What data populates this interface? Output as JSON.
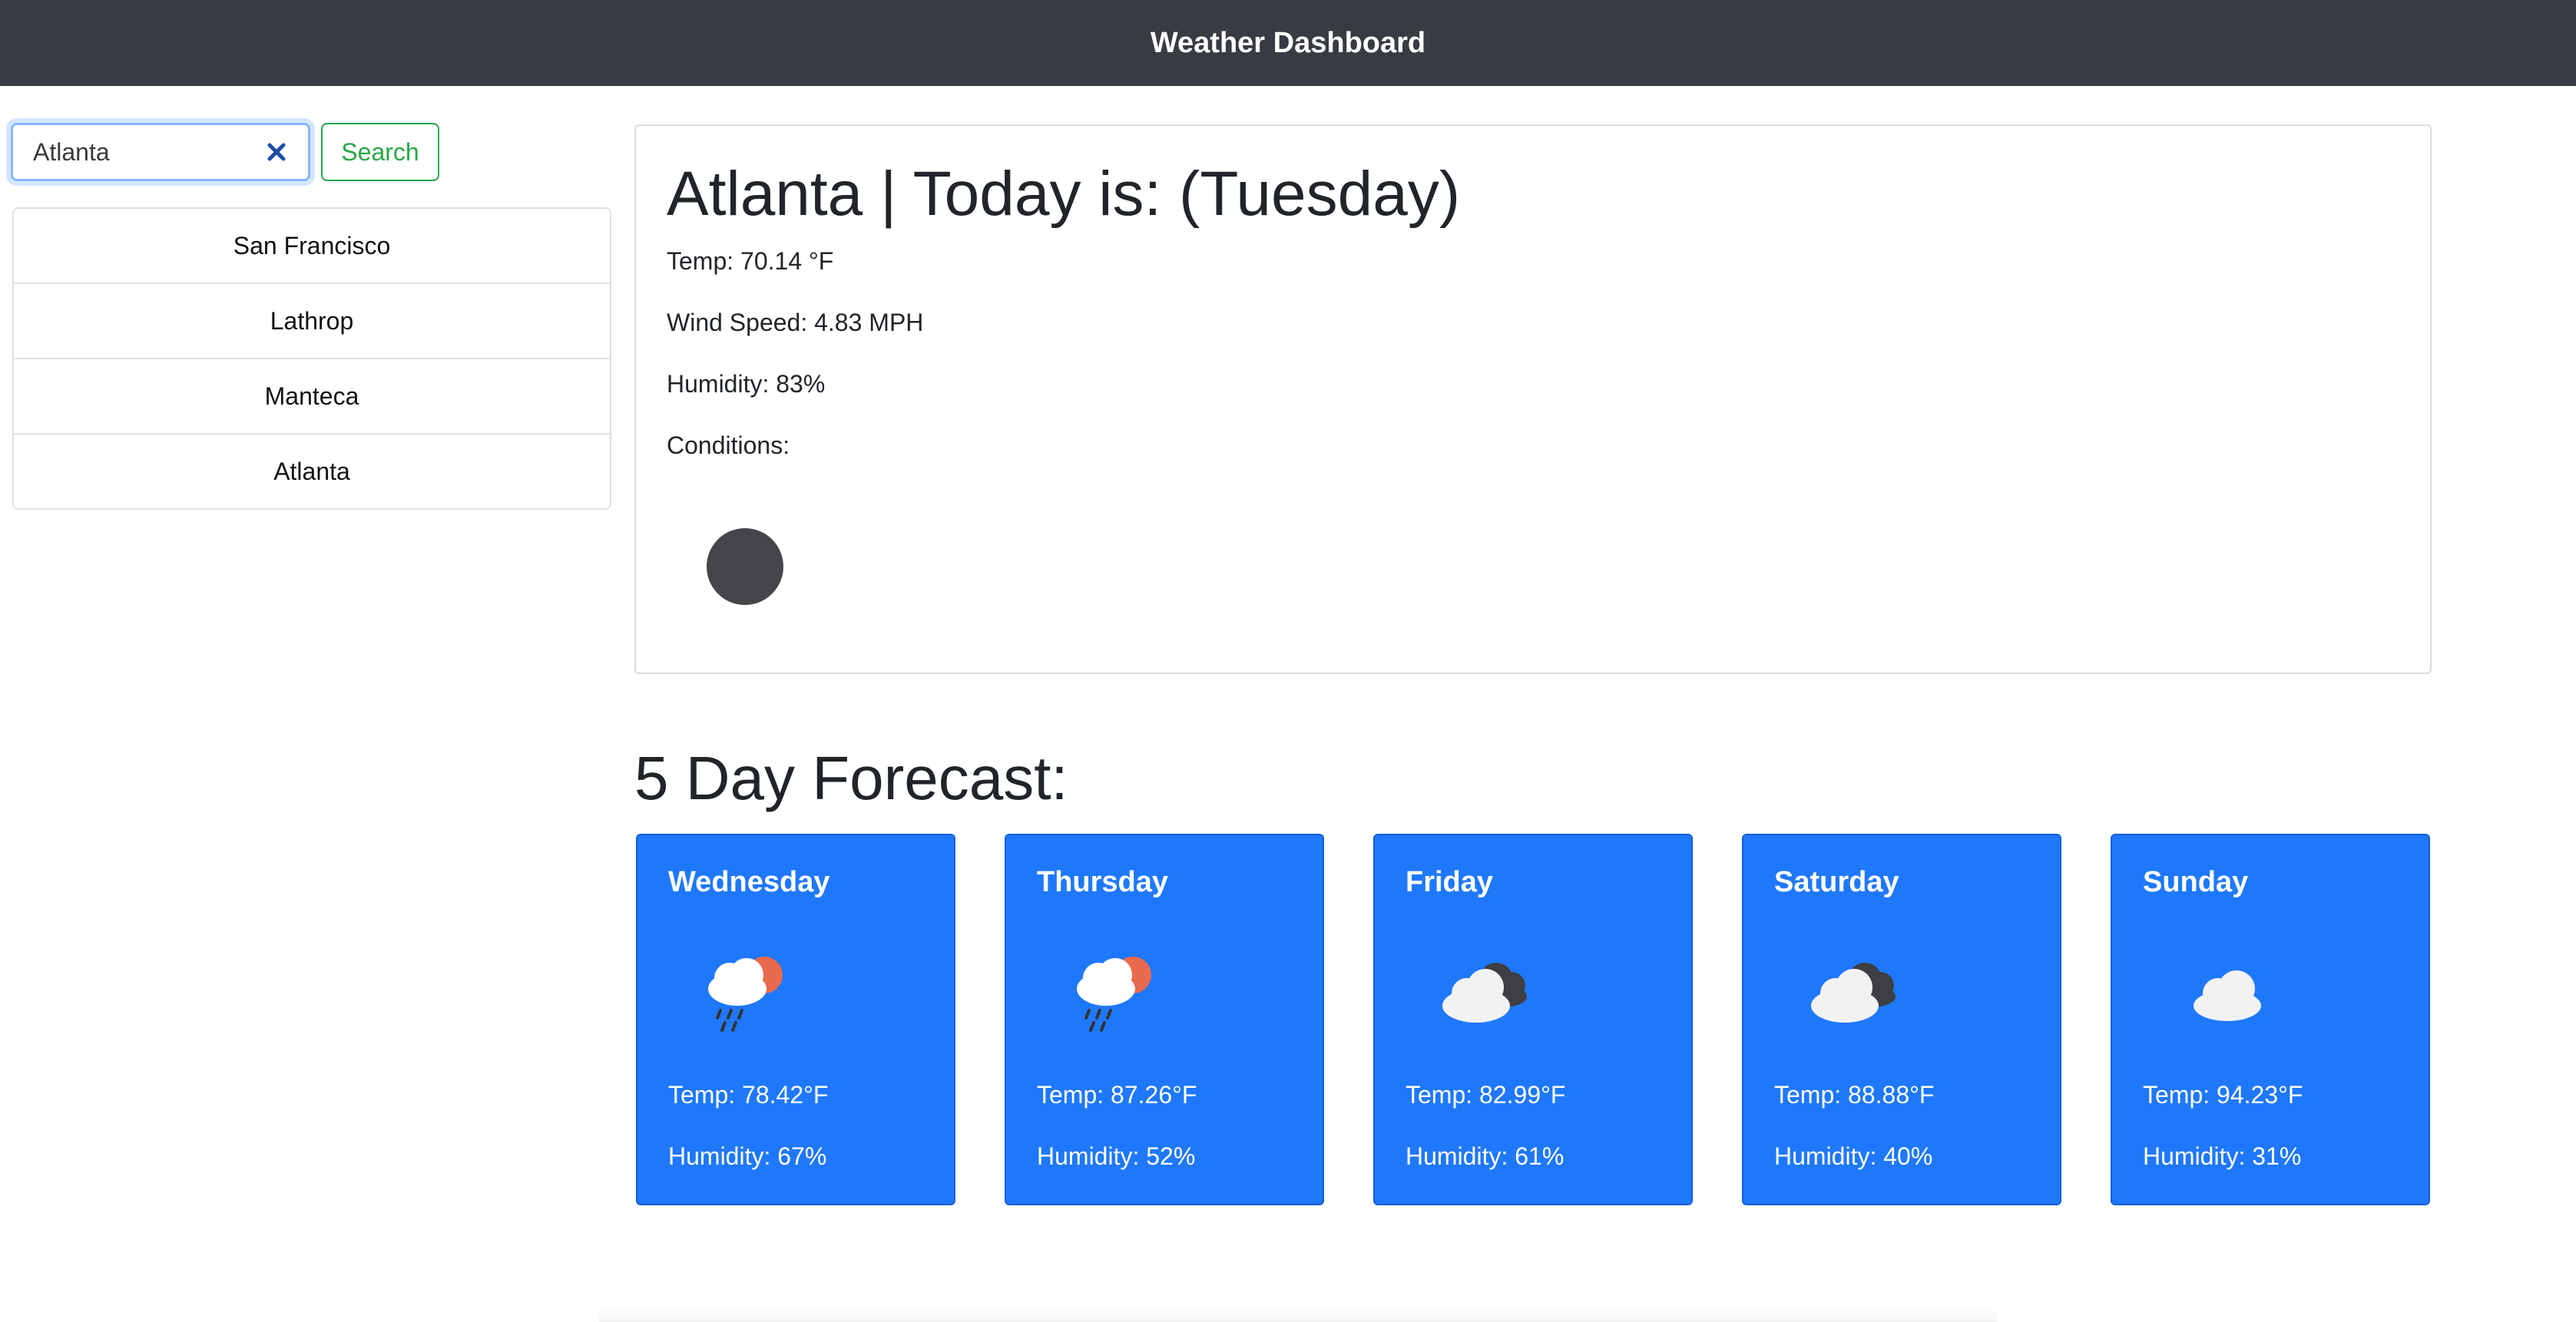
{
  "header": {
    "title": "Weather Dashboard"
  },
  "search": {
    "value": "Atlanta",
    "button_label": "Search"
  },
  "history": [
    "San Francisco",
    "Lathrop",
    "Manteca",
    "Atlanta"
  ],
  "current": {
    "title": "Atlanta | Today is: (Tuesday)",
    "temp": "Temp: 70.14 °F",
    "wind": "Wind Speed: 4.83 MPH",
    "humidity": "Humidity: 83%",
    "conditions_label": "Conditions:",
    "conditions_icon": "dark-circle-icon"
  },
  "forecast": {
    "heading": "5 Day Forecast:",
    "days": [
      {
        "day": "Wednesday",
        "temp": "Temp: 78.42°F",
        "humidity": "Humidity: 67%",
        "icon": "rain-sun-icon"
      },
      {
        "day": "Thursday",
        "temp": "Temp: 87.26°F",
        "humidity": "Humidity: 52%",
        "icon": "rain-sun-icon"
      },
      {
        "day": "Friday",
        "temp": "Temp: 82.99°F",
        "humidity": "Humidity: 61%",
        "icon": "broken-clouds-icon"
      },
      {
        "day": "Saturday",
        "temp": "Temp: 88.88°F",
        "humidity": "Humidity: 40%",
        "icon": "broken-clouds-icon"
      },
      {
        "day": "Sunday",
        "temp": "Temp: 94.23°F",
        "humidity": "Humidity: 31%",
        "icon": "cloud-icon"
      }
    ]
  },
  "colors": {
    "topbar": "#383b41",
    "card_blue": "#1f78fb",
    "search_green": "#28a745"
  }
}
